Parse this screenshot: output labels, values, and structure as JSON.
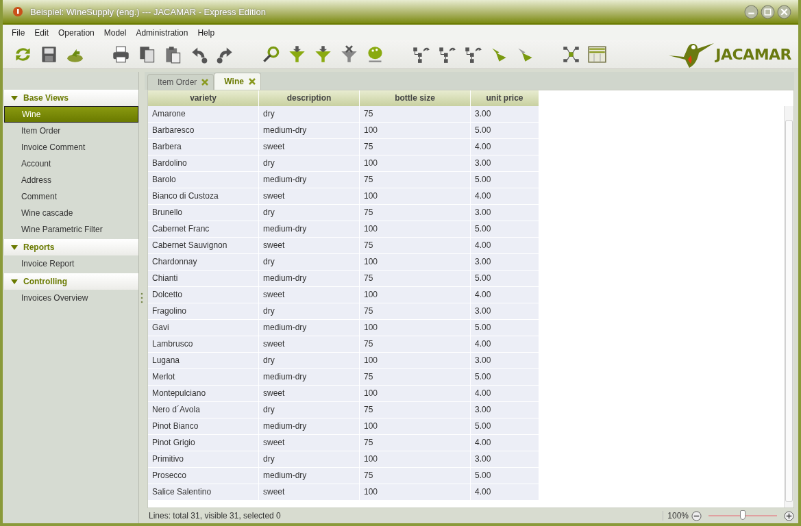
{
  "window": {
    "title": "Beispiel: WineSupply (eng.) --- JACAMAR - Express Edition"
  },
  "menu": [
    "File",
    "Edit",
    "Operation",
    "Model",
    "Administration",
    "Help"
  ],
  "logo": {
    "text": "JACAMAR"
  },
  "sidebar": {
    "sections": [
      {
        "title": "Base Views",
        "expanded": true,
        "items": [
          {
            "label": "Wine",
            "selected": true
          },
          {
            "label": "Item Order",
            "selected": false
          },
          {
            "label": "Invoice Comment",
            "selected": false
          },
          {
            "label": "Account",
            "selected": false
          },
          {
            "label": "Address",
            "selected": false
          },
          {
            "label": "Comment",
            "selected": false
          },
          {
            "label": "Wine cascade",
            "selected": false
          },
          {
            "label": "Wine Parametric Filter",
            "selected": false
          }
        ]
      },
      {
        "title": "Reports",
        "expanded": true,
        "items": [
          {
            "label": "Invoice Report",
            "selected": false
          }
        ]
      },
      {
        "title": "Controlling",
        "expanded": true,
        "items": [
          {
            "label": "Invoices Overview",
            "selected": false
          }
        ]
      }
    ]
  },
  "tabs": [
    {
      "label": "Item Order",
      "selected": false
    },
    {
      "label": "Wine",
      "selected": true
    }
  ],
  "table": {
    "columns": [
      "variety",
      "description",
      "bottle size",
      "unit price"
    ],
    "rows": [
      [
        "Amarone",
        "dry",
        "75",
        "3.00"
      ],
      [
        "Barbaresco",
        "medium-dry",
        "100",
        "5.00"
      ],
      [
        "Barbera",
        "sweet",
        "75",
        "4.00"
      ],
      [
        "Bardolino",
        "dry",
        "100",
        "3.00"
      ],
      [
        "Barolo",
        "medium-dry",
        "75",
        "5.00"
      ],
      [
        "Bianco di Custoza",
        "sweet",
        "100",
        "4.00"
      ],
      [
        "Brunello",
        "dry",
        "75",
        "3.00"
      ],
      [
        "Cabernet Franc",
        "medium-dry",
        "100",
        "5.00"
      ],
      [
        "Cabernet Sauvignon",
        "sweet",
        "75",
        "4.00"
      ],
      [
        "Chardonnay",
        "dry",
        "100",
        "3.00"
      ],
      [
        "Chianti",
        "medium-dry",
        "75",
        "5.00"
      ],
      [
        "Dolcetto",
        "sweet",
        "100",
        "4.00"
      ],
      [
        "Fragolino",
        "dry",
        "75",
        "3.00"
      ],
      [
        "Gavi",
        "medium-dry",
        "100",
        "5.00"
      ],
      [
        "Lambrusco",
        "sweet",
        "75",
        "4.00"
      ],
      [
        "Lugana",
        "dry",
        "100",
        "3.00"
      ],
      [
        "Merlot",
        "medium-dry",
        "75",
        "5.00"
      ],
      [
        "Montepulciano",
        "sweet",
        "100",
        "4.00"
      ],
      [
        "Nero d´Avola",
        "dry",
        "75",
        "3.00"
      ],
      [
        "Pinot Bianco",
        "medium-dry",
        "100",
        "5.00"
      ],
      [
        "Pinot Grigio",
        "sweet",
        "75",
        "4.00"
      ],
      [
        "Primitivo",
        "dry",
        "100",
        "3.00"
      ],
      [
        "Prosecco",
        "medium-dry",
        "75",
        "5.00"
      ],
      [
        "Salice Salentino",
        "sweet",
        "100",
        "4.00"
      ]
    ]
  },
  "status_bar": {
    "text": "Lines: total 31, visible 31, selected 0",
    "zoom": "100%",
    "zoom_slider": {
      "level": 0.5
    }
  }
}
